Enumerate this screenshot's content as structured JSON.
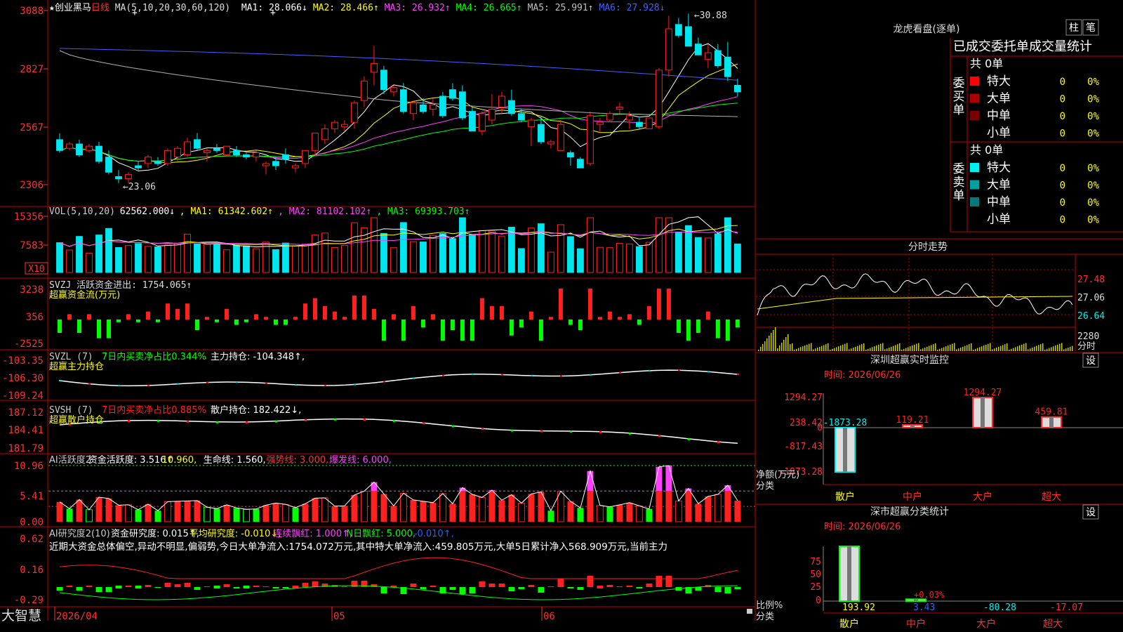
{
  "app": {
    "name": "大智慧"
  },
  "colors": {
    "up": "#ff2020",
    "down": "#00e5ee",
    "ma1": "#ffffff",
    "ma2": "#ffff00",
    "ma3": "#ff40ff",
    "ma4": "#00ff00",
    "ma5": "#b0b0b0",
    "ma6": "#4060ff",
    "frame": "#c00000",
    "scale": "#ff3030"
  },
  "main": {
    "star": "★",
    "title": "创业黑马",
    "period": "日线",
    "ma_params": "MA(5,10,20,30,60,120)",
    "ma_values": [
      {
        "label": "MA1:",
        "value": "28.066↓",
        "color": "#ffffff"
      },
      {
        "label": "MA2:",
        "value": "28.466↑",
        "color": "#ffff00"
      },
      {
        "label": "MA3:",
        "value": "26.932↑",
        "color": "#ff40ff"
      },
      {
        "label": "MA4:",
        "value": "26.665↑",
        "color": "#00ff00"
      },
      {
        "label": "MA5:",
        "value": "25.991↑",
        "color": "#c0c0c0"
      },
      {
        "label": "MA6:",
        "value": "27.928↓",
        "color": "#4060ff"
      }
    ],
    "high_mark": "30.88",
    "low_mark": "←23.06",
    "y_ticks": [
      "3088",
      "2827",
      "2567",
      "2306"
    ]
  },
  "vol": {
    "header": "VOL(5,10,20)",
    "value": "62562.000↓",
    "ma1": "MA1: 61342.602↑",
    "ma2": "MA2: 81102.102↑",
    "ma3": "MA3: 69393.703↑",
    "unit": "X10",
    "y_ticks": [
      "15356",
      "7583"
    ]
  },
  "svzj": {
    "header": "SVZJ",
    "l1": "活跃资金进出: 1754.065↑",
    "l2": "超赢资金流(万元)",
    "y_ticks": [
      "3238",
      "356",
      "-2525"
    ]
  },
  "svzl": {
    "header": "SVZL (7)",
    "l1": "7日内买卖净占比0.344%",
    "l2": "主力持仓: -104.348↑,",
    "l3": "超赢主力持仓",
    "y_ticks": [
      "-103.35",
      "-106.30",
      "-109.24"
    ]
  },
  "svsh": {
    "header": "SVSH (7)",
    "l1": "7日内买卖净占比0.885%",
    "l2": "散户持仓: 182.422↓,",
    "l3": "超赢散户持仓",
    "y_ticks": [
      "187.12",
      "184.41",
      "181.79"
    ]
  },
  "ai1": {
    "header": "AI活跃度2",
    "l1": "资金活跃度: 3.516↑",
    "l2": "10.960,",
    "l3": "生命线: 1.560,",
    "l4": "强势线: 3.000,",
    "l5": "爆发线: 6.000,",
    "y_ticks": [
      "10.96",
      "5.41",
      "0.00"
    ]
  },
  "ai2": {
    "header": "AI研究度2(10)",
    "l1": "资金研究度: 0.015↑,",
    "l2": "平均研究度: -0.010↓,",
    "l3": "连续飘红: 1.000↑,",
    "l4": "N日飘红: 5.000,",
    "l5": "-0.010↑,",
    "text": "近期大资金总体偏空,异动不明显,偏弱势,今日大单净流入:1754.072万元,其中特大单净流入:459.805万元,大单5日累计净入568.909万元,当前主力",
    "y_ticks": [
      "0.62",
      "0.16",
      "-0.29"
    ]
  },
  "x_axis": {
    "labels": [
      "2026/04",
      "05",
      "06"
    ]
  },
  "right": {
    "dragon": {
      "title": "龙虎看盘(逐单)",
      "btn1": "柱",
      "btn2": "笔",
      "subtitle": "已成交委托单成交量统计",
      "buy_label": "委买单",
      "sell_label": "委卖单",
      "buy_total": "共 0单",
      "sell_total": "共 0单",
      "buy_rows": [
        {
          "name": "特大",
          "v": "0",
          "p": "0%"
        },
        {
          "name": "大单",
          "v": "0",
          "p": "0%"
        },
        {
          "name": "中单",
          "v": "0",
          "p": "0%"
        },
        {
          "name": "小单",
          "v": "0",
          "p": "0%"
        }
      ],
      "sell_rows": [
        {
          "name": "特大",
          "v": "0",
          "p": "0%"
        },
        {
          "name": "大单",
          "v": "0",
          "p": "0%"
        },
        {
          "name": "中单",
          "v": "0",
          "p": "0%"
        },
        {
          "name": "小单",
          "v": "0",
          "p": "0%"
        }
      ]
    },
    "intraday": {
      "title": "分时走势",
      "p1": "27.48",
      "p2": "27.06",
      "p3": "26.64",
      "vol": "2280",
      "unit": "分时"
    },
    "monitor": {
      "title": "深圳超赢实时监控",
      "btn": "设",
      "time": "时间: 2026/06/26",
      "y_ticks": [
        "1294.27",
        "238.42",
        "0",
        "-817.43",
        "-1873.28"
      ],
      "ylabel1": "净额(万元)",
      "ylabel2": "分类",
      "categories": [
        "散户",
        "中户",
        "大户",
        "超大"
      ],
      "values": [
        -1873.28,
        119.21,
        1294.27,
        459.81
      ],
      "labels": [
        "-1873.28",
        "119.21",
        "1294.27",
        "459.81"
      ]
    },
    "classify": {
      "title": "深市超赢分类统计",
      "btn": "设",
      "time": "时间: 2026/06/26",
      "y_ticks": [
        "75",
        "50",
        "25",
        "0"
      ],
      "ylabel1": "比例%",
      "ylabel2": "分类",
      "categories": [
        "散户",
        "中户",
        "大户",
        "超大"
      ],
      "values": [
        193.92,
        3.43,
        -80.28,
        -17.07
      ],
      "labels": [
        "193.92",
        "3.43",
        "-80.28",
        "-17.07"
      ],
      "annot": "+0.03%"
    }
  },
  "chart_data": {
    "type": "candlestick",
    "title": "创业黑马 日线",
    "ylim": [
      23.0,
      31.0
    ],
    "x": [
      "2026/04",
      "",
      "",
      "",
      "",
      "",
      "",
      "",
      "",
      "",
      "",
      "",
      "",
      "",
      "",
      "",
      "",
      "",
      "",
      "",
      "",
      "",
      "",
      "",
      "",
      "05",
      "",
      "",
      "",
      "",
      "",
      "",
      "",
      "",
      "",
      "",
      "",
      "",
      "",
      "",
      "",
      "",
      "",
      "",
      "",
      "",
      "06",
      "",
      "",
      "",
      "",
      "",
      "",
      "",
      "",
      "",
      "",
      "",
      "",
      "",
      "",
      ""
    ],
    "ohlc": [
      [
        25.1,
        25.4,
        24.5,
        24.6
      ],
      [
        24.7,
        25.0,
        24.6,
        24.9
      ],
      [
        24.9,
        25.1,
        24.3,
        24.4
      ],
      [
        24.6,
        24.9,
        24.5,
        24.8
      ],
      [
        24.8,
        25.0,
        24.0,
        24.1
      ],
      [
        24.3,
        24.6,
        23.5,
        23.6
      ],
      [
        23.4,
        23.7,
        23.1,
        23.3
      ],
      [
        23.3,
        23.6,
        23.1,
        23.5
      ],
      [
        23.9,
        24.1,
        23.7,
        23.8
      ],
      [
        24.0,
        24.4,
        23.8,
        24.3
      ],
      [
        24.1,
        24.3,
        23.9,
        24.0
      ],
      [
        24.0,
        24.7,
        23.9,
        24.6
      ],
      [
        24.3,
        24.8,
        24.1,
        24.7
      ],
      [
        24.4,
        25.2,
        24.3,
        25.0
      ],
      [
        25.1,
        25.4,
        24.6,
        24.7
      ],
      [
        24.5,
        24.7,
        24.1,
        24.6
      ],
      [
        24.7,
        24.9,
        24.5,
        24.6
      ],
      [
        24.4,
        24.8,
        24.3,
        24.8
      ],
      [
        24.6,
        24.8,
        24.3,
        24.4
      ],
      [
        24.4,
        24.5,
        24.2,
        24.3
      ],
      [
        24.3,
        24.6,
        24.1,
        24.5
      ],
      [
        23.9,
        24.1,
        23.5,
        24.0
      ],
      [
        24.1,
        24.3,
        23.7,
        23.9
      ],
      [
        24.4,
        24.7,
        24.0,
        24.2
      ],
      [
        23.8,
        24.0,
        23.6,
        23.9
      ],
      [
        24.0,
        24.6,
        23.8,
        24.6
      ],
      [
        24.6,
        25.4,
        24.4,
        25.4
      ],
      [
        25.1,
        25.8,
        24.9,
        25.6
      ],
      [
        25.6,
        26.0,
        25.4,
        25.9
      ],
      [
        25.7,
        26.0,
        25.5,
        25.8
      ],
      [
        25.9,
        26.9,
        25.6,
        26.8
      ],
      [
        26.9,
        28.0,
        26.6,
        27.8
      ],
      [
        28.2,
        29.4,
        27.6,
        28.6
      ],
      [
        28.3,
        28.5,
        27.2,
        27.4
      ],
      [
        27.3,
        27.6,
        27.1,
        27.5
      ],
      [
        27.4,
        27.7,
        26.3,
        26.4
      ],
      [
        26.3,
        26.9,
        26.0,
        26.8
      ],
      [
        26.7,
        27.0,
        26.3,
        26.4
      ],
      [
        26.5,
        27.0,
        26.2,
        26.7
      ],
      [
        27.1,
        27.3,
        26.1,
        26.2
      ],
      [
        27.4,
        27.7,
        26.9,
        27.0
      ],
      [
        27.3,
        27.6,
        26.0,
        26.1
      ],
      [
        26.4,
        26.6,
        25.5,
        25.5
      ],
      [
        25.5,
        26.4,
        25.3,
        26.3
      ],
      [
        26.0,
        27.2,
        25.8,
        26.5
      ],
      [
        26.6,
        27.3,
        26.3,
        27.1
      ],
      [
        26.9,
        27.4,
        26.2,
        26.3
      ],
      [
        26.3,
        26.5,
        25.9,
        26.0
      ],
      [
        25.7,
        26.1,
        24.8,
        26.0
      ],
      [
        25.8,
        26.2,
        24.9,
        25.0
      ],
      [
        24.9,
        25.1,
        24.7,
        25.0
      ],
      [
        24.6,
        26.0,
        24.6,
        25.8
      ],
      [
        24.5,
        24.6,
        23.9,
        24.3
      ],
      [
        24.2,
        24.3,
        23.8,
        23.8
      ],
      [
        24.0,
        26.4,
        23.9,
        26.2
      ],
      [
        25.8,
        26.1,
        25.4,
        25.9
      ],
      [
        26.0,
        26.4,
        25.9,
        26.3
      ],
      [
        26.5,
        26.8,
        26.3,
        26.6
      ],
      [
        26.0,
        26.4,
        25.6,
        26.2
      ],
      [
        25.9,
        26.1,
        25.6,
        25.7
      ],
      [
        25.6,
        26.1,
        25.6,
        26.1
      ],
      [
        25.7,
        28.4,
        25.6,
        28.3
      ],
      [
        28.3,
        30.8,
        28.0,
        30.2
      ],
      [
        30.4,
        30.7,
        29.8,
        29.9
      ],
      [
        30.3,
        30.9,
        29.4,
        29.4
      ],
      [
        29.5,
        29.8,
        29.0,
        29.0
      ],
      [
        28.8,
        29.5,
        28.4,
        29.1
      ],
      [
        29.2,
        29.5,
        28.4,
        28.5
      ],
      [
        28.9,
        29.6,
        27.8,
        28.0
      ],
      [
        27.6,
        27.9,
        27.1,
        27.3
      ]
    ]
  }
}
